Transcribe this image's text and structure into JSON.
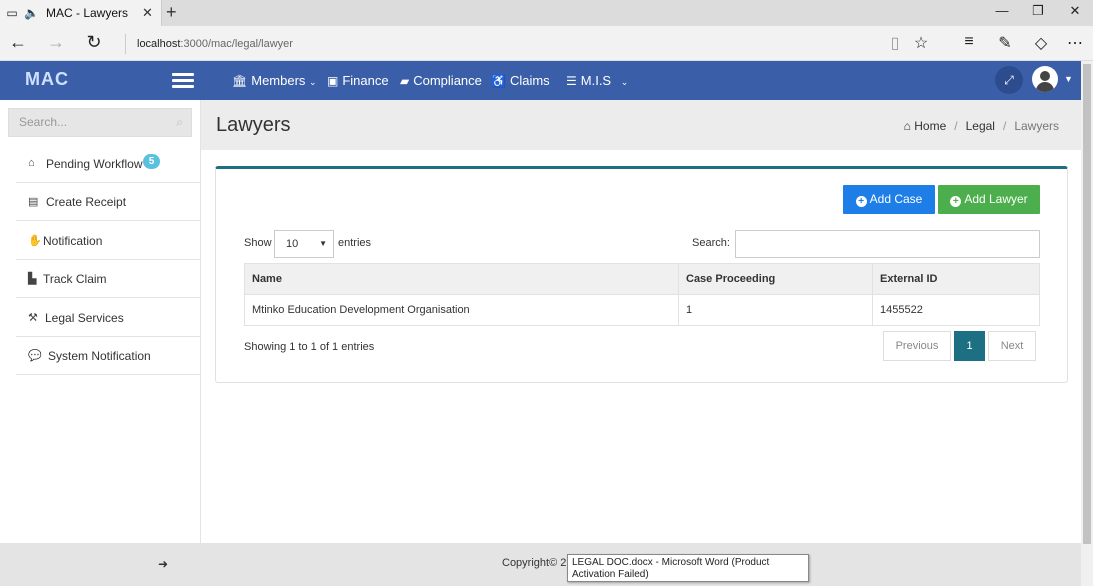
{
  "browser": {
    "tab_title": "MAC - Lawyers",
    "url_host": "localhost",
    "url_rest": ":3000/mac/legal/lawyer"
  },
  "header": {
    "logo": "MAC",
    "menu": [
      "Members",
      "Finance",
      "Compliance",
      "Claims",
      "M.I.S"
    ]
  },
  "sidebar": {
    "search_placeholder": "Search...",
    "items": [
      {
        "label": "Pending Workflow",
        "badge": "5"
      },
      {
        "label": "Create Receipt"
      },
      {
        "label": "Notification"
      },
      {
        "label": "Track Claim"
      },
      {
        "label": "Legal Services"
      },
      {
        "label": "System Notification"
      }
    ]
  },
  "page": {
    "title": "Lawyers",
    "breadcrumb": [
      "Home",
      "Legal",
      "Lawyers"
    ],
    "add_case": "Add Case",
    "add_lawyer": "Add Lawyer",
    "show_label": "Show",
    "entries_label": "entries",
    "page_length": "10",
    "search_label": "Search:",
    "columns": [
      "Name",
      "Case Proceeding",
      "External ID"
    ],
    "rows": [
      [
        "Mtinko Education Development Organisation",
        "1",
        "1455522"
      ]
    ],
    "info": "Showing 1 to 1 of 1 entries",
    "pagination": {
      "previous": "Previous",
      "current": "1",
      "next": "Next"
    }
  },
  "footer": {
    "copyright": "Copyright© 2",
    "tooltip": "LEGAL DOC.docx - Microsoft Word (Product Activation Failed)"
  },
  "colors": {
    "header_blue": "#3a5fa8",
    "teal": "#1d6f84",
    "btn_blue": "#1e7ee8",
    "btn_green": "#4cae4c",
    "badge": "#5bc0de"
  }
}
